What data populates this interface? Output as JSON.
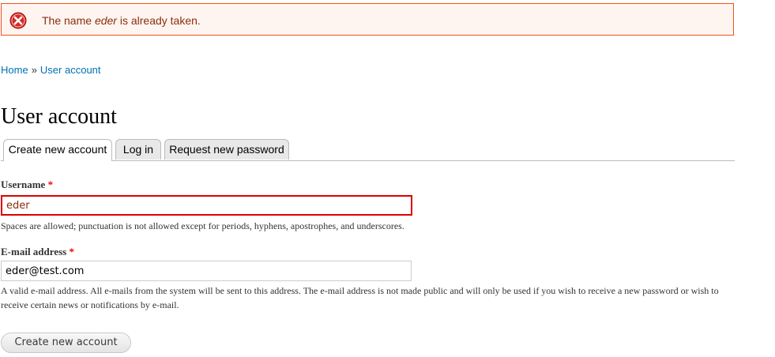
{
  "messages": {
    "error_prefix": "The name ",
    "error_name": "eder",
    "error_suffix": " is already taken.",
    "icon": "error-x-icon",
    "colors": {
      "border": "#ed541d",
      "background": "#fef5f1",
      "text": "#8c2e0b"
    }
  },
  "breadcrumb": {
    "items": [
      {
        "label": "Home"
      },
      {
        "label": "User account"
      }
    ],
    "separator": "»"
  },
  "page": {
    "title": "User account"
  },
  "tabs": [
    {
      "label": "Create new account",
      "active": true
    },
    {
      "label": "Log in",
      "active": false
    },
    {
      "label": "Request new password",
      "active": false
    }
  ],
  "form": {
    "username": {
      "label": "Username",
      "required_mark": "*",
      "value": "eder",
      "description": "Spaces are allowed; punctuation is not allowed except for periods, hyphens, apostrophes, and underscores."
    },
    "email": {
      "label": "E-mail address",
      "required_mark": "*",
      "value": "eder@test.com",
      "description": "A valid e-mail address. All e-mails from the system will be sent to this address. The e-mail address is not made public and will only be used if you wish to receive a new password or wish to receive certain news or notifications by e-mail."
    },
    "submit_label": "Create new account"
  }
}
